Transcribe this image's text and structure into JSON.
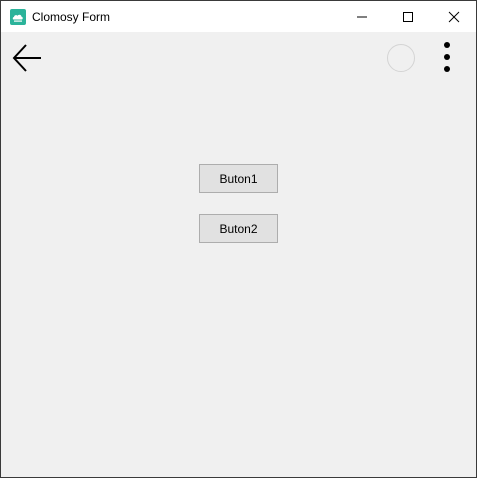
{
  "window": {
    "title": "Clomosy Form",
    "app_icon": "clomosy-app-icon",
    "controls": {
      "minimize_icon": "minimize-icon",
      "maximize_icon": "maximize-icon",
      "close_icon": "close-icon"
    }
  },
  "toolbar": {
    "back_icon": "arrow-left-icon",
    "circle_icon": "circle-icon",
    "more_icon": "more-vertical-icon"
  },
  "content": {
    "button1_label": "Buton1",
    "button2_label": "Buton2"
  },
  "colors": {
    "accent": "#2bb39a",
    "titlebar_bg": "#ffffff",
    "body_bg": "#f0f0f0",
    "button_bg": "#e1e1e1",
    "button_border": "#adadad"
  }
}
